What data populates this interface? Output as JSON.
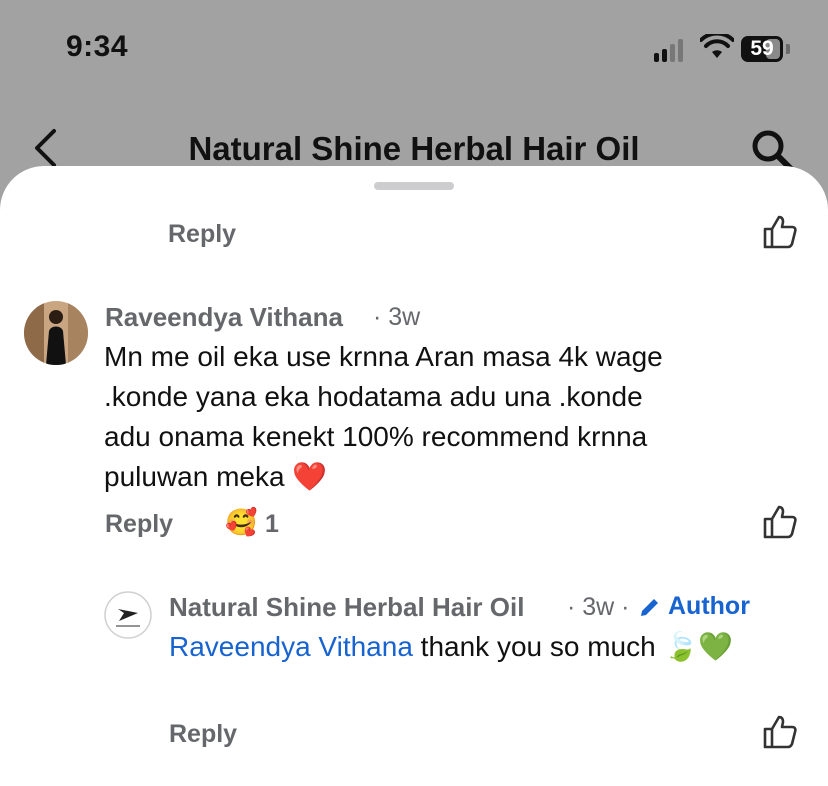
{
  "status_bar": {
    "time": "9:34",
    "battery": "59"
  },
  "header": {
    "title": "Natural Shine Herbal Hair Oil"
  },
  "thread": {
    "top_reply_label": "Reply",
    "comment": {
      "author": "Raveendya Vithana",
      "age": "· 3w",
      "text": "Mn me oil eka use krnna Aran masa 4k wage .konde yana eka hodatama adu una .konde adu onama kenekt 100% recommend krnna puluwan meka ❤️",
      "reply_label": "Reply",
      "reaction_emoji": "🥰",
      "reaction_count": "1"
    },
    "reply": {
      "author": "Natural Shine Herbal Hair Oil",
      "age": "· 3w ·",
      "badge": "Author",
      "mention": "Raveendya Vithana",
      "text": " thank you so much 🍃💚",
      "reply_label": "Reply"
    }
  },
  "colors": {
    "header_bg": "#a2a2a2",
    "secondary_text": "#65676b",
    "link": "#1763cf"
  }
}
